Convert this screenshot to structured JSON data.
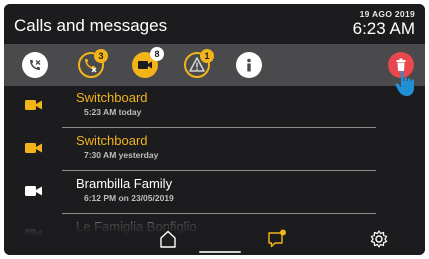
{
  "header": {
    "title": "Calls and messages",
    "date": "19 AGO 2019",
    "time": "6:23 AM"
  },
  "toolbar": {
    "missed_badge": "3",
    "video_badge": "8",
    "alert_badge": "1"
  },
  "rows": [
    {
      "name": "Switchboard",
      "sub": "5:23 AM today",
      "color": "#f2b418"
    },
    {
      "name": "Switchboard",
      "sub": "7:30 AM yesterday",
      "color": "#f2b418"
    },
    {
      "name": "Brambilla Family",
      "sub": "6:12 PM on 23/05/2019",
      "color": "#ffffff"
    },
    {
      "name": "Le Famiglia Bonfiglio",
      "sub": "",
      "color": "#ffffff"
    }
  ],
  "colors": {
    "accent": "#f2b418",
    "delete": "#e8474d",
    "cursor": "#1f8fd6"
  }
}
